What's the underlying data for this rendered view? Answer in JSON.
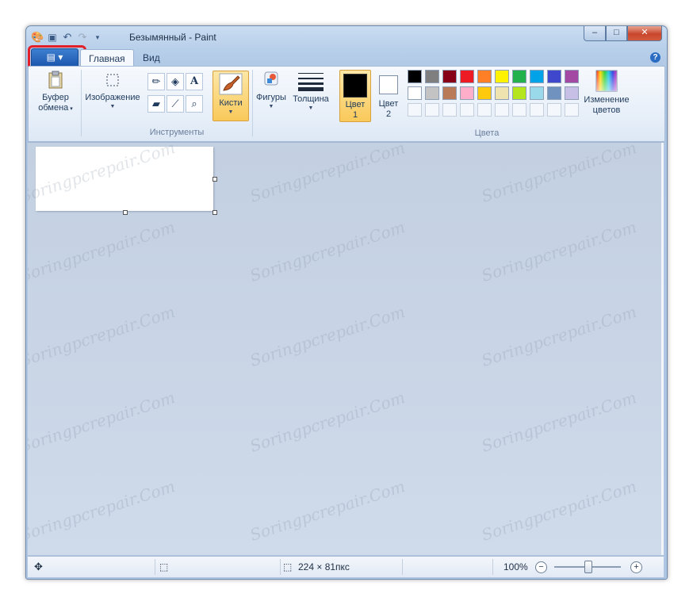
{
  "window": {
    "title": "Безымянный - Paint",
    "controls": {
      "minimize": "–",
      "maximize": "□",
      "close": "✕"
    }
  },
  "quick_access": [
    "paint-icon",
    "save-icon",
    "undo-icon",
    "redo-icon",
    "customize-icon"
  ],
  "app_menu": {
    "icon": "menu-icon"
  },
  "tabs": [
    {
      "label": "Главная",
      "active": true
    },
    {
      "label": "Вид",
      "active": false
    }
  ],
  "help": "?",
  "ribbon": {
    "clipboard": {
      "label_line1": "Буфер",
      "label_line2": "обмена"
    },
    "image": {
      "label": "Изображение"
    },
    "tools": {
      "group_label": "Инструменты"
    },
    "brushes": {
      "label": "Кисти"
    },
    "shapes": {
      "label": "Фигуры"
    },
    "size": {
      "label": "Толщина"
    },
    "color1": {
      "line1": "Цвет",
      "line2": "1",
      "value": "#000000"
    },
    "color2": {
      "line1": "Цвет",
      "line2": "2",
      "value": "#ffffff"
    },
    "colors": {
      "group_label": "Цвета",
      "row1": [
        "#000000",
        "#7f7f7f",
        "#880015",
        "#ed1c24",
        "#ff7f27",
        "#fff200",
        "#22b14c",
        "#00a2e8",
        "#3f48cc",
        "#a349a4"
      ],
      "row2": [
        "#ffffff",
        "#c3c3c3",
        "#b97a57",
        "#ffaec9",
        "#ffc90e",
        "#efe4b0",
        "#b5e61d",
        "#99d9ea",
        "#7092be",
        "#c8bfe7"
      ],
      "row3_empty": 10
    },
    "edit_colors": {
      "line1": "Изменение",
      "line2": "цветов"
    }
  },
  "watermark": "Soringpcrepair.Com",
  "statusbar": {
    "image_size": "224 × 81пкс",
    "zoom": "100%",
    "zoom_fraction": 0.5,
    "zoom_out": "−",
    "zoom_in": "+"
  }
}
